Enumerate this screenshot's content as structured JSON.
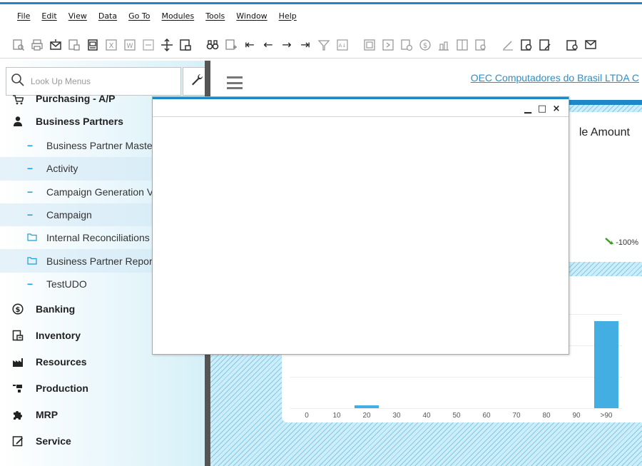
{
  "menubar": {
    "items": [
      "File",
      "Edit",
      "View",
      "Data",
      "Go To",
      "Modules",
      "Tools",
      "Window",
      "Help"
    ]
  },
  "toolbar": {
    "icons": [
      "preview-icon",
      "print-icon",
      "email-icon",
      "export-icon",
      "fax-icon",
      "excel-icon",
      "word-icon",
      "pdf-icon",
      "move-icon",
      "lock-icon",
      "find-icon",
      "add-icon",
      "first-record-icon",
      "previous-record-icon",
      "next-record-icon",
      "last-record-icon",
      "filter-icon",
      "sort-icon",
      "base-document-icon",
      "target-document-icon",
      "gross-profit-icon",
      "payment-means-icon",
      "volume-weight-icon",
      "journal-icon",
      "transaction-icon",
      "edit-icon",
      "settings-icon",
      "form-settings-icon",
      "messages-icon",
      "alerts-icon"
    ]
  },
  "sidebar": {
    "search_placeholder": "Look Up Menus",
    "items": [
      {
        "label": "Purchasing - A/P",
        "icon": "cart-icon"
      },
      {
        "label": "Business Partners",
        "icon": "person-icon"
      },
      {
        "label": "Banking",
        "icon": "dollar-icon"
      },
      {
        "label": "Inventory",
        "icon": "inventory-icon"
      },
      {
        "label": "Resources",
        "icon": "factory-icon"
      },
      {
        "label": "Production",
        "icon": "production-icon"
      },
      {
        "label": "MRP",
        "icon": "puzzle-icon"
      },
      {
        "label": "Service",
        "icon": "service-icon"
      }
    ],
    "subitems": [
      {
        "label": "Business Partner Maste",
        "icon": "dash-icon"
      },
      {
        "label": "Activity",
        "icon": "dash-icon"
      },
      {
        "label": "Campaign Generation V",
        "icon": "dash-icon"
      },
      {
        "label": "Campaign",
        "icon": "dash-icon"
      },
      {
        "label": "Internal Reconciliations",
        "icon": "folder-icon"
      },
      {
        "label": "Business Partner Repor",
        "icon": "folder-icon"
      },
      {
        "label": "TestUDO",
        "icon": "dash-icon"
      }
    ]
  },
  "content": {
    "company": "OEC Computadores do Brasil LTDA",
    "company_trail": "C",
    "card_title": "le Amount",
    "trend": "-100%"
  },
  "chart_data": {
    "type": "bar",
    "categories": [
      "0",
      "10",
      "20",
      "30",
      "40",
      "50",
      "60",
      "70",
      "80",
      "90",
      ">90"
    ],
    "values": [
      0,
      0,
      1,
      0,
      0,
      0,
      0,
      0,
      0,
      0,
      30
    ],
    "ylim": [
      0,
      32
    ]
  },
  "dialog": {
    "minimize": "▁",
    "maximize": "□",
    "close": "×"
  },
  "colors": {
    "accent": "#1e88c7",
    "bar": "#42aee2",
    "link": "#2a8fce",
    "trend_arrow": "#3aa01f"
  }
}
